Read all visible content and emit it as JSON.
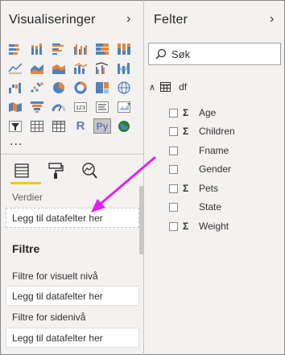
{
  "visualizations": {
    "title": "Visualiseringer",
    "icons": [
      "stacked-bar-icon",
      "stacked-column-icon",
      "clustered-bar-icon",
      "clustered-column-icon",
      "100-bar-icon",
      "100-column-icon",
      "line-chart-icon",
      "area-chart-icon",
      "stacked-area-icon",
      "line-column-icon",
      "line-clustered-column-icon",
      "ribbon-chart-icon",
      "waterfall-icon",
      "scatter-icon",
      "pie-chart-icon",
      "donut-chart-icon",
      "treemap-icon",
      "map-icon",
      "filled-map-icon",
      "funnel-icon",
      "gauge-icon",
      "card-icon",
      "multirow-card-icon",
      "kpi-icon",
      "slicer-icon",
      "table-icon",
      "matrix-icon",
      "r-visual-icon",
      "python-visual-icon",
      "arcgis-icon"
    ],
    "r_label": "R",
    "py_label": "Py",
    "more": "...",
    "values_label": "Verdier",
    "values_well": "Legg til datafelter her",
    "filters_title": "Filtre",
    "visual_filters_label": "Filtre for visuelt nivå",
    "visual_filters_well": "Legg til datafelter her",
    "page_filters_label": "Filtre for sidenivå",
    "page_filters_well": "Legg til datafelter her"
  },
  "fields": {
    "title": "Felter",
    "search_placeholder": "Søk",
    "table_name": "df",
    "items": [
      {
        "name": "Age",
        "sigma": true
      },
      {
        "name": "Children",
        "sigma": true
      },
      {
        "name": "Fname",
        "sigma": false
      },
      {
        "name": "Gender",
        "sigma": false
      },
      {
        "name": "Pets",
        "sigma": true
      },
      {
        "name": "State",
        "sigma": false
      },
      {
        "name": "Weight",
        "sigma": true
      }
    ],
    "sigma_symbol": "Σ"
  },
  "colors": {
    "accent_yellow": "#f2c811",
    "arrow_magenta": "#e31ef5",
    "chart_orange": "#e8853a",
    "chart_blue": "#4f81bd"
  }
}
